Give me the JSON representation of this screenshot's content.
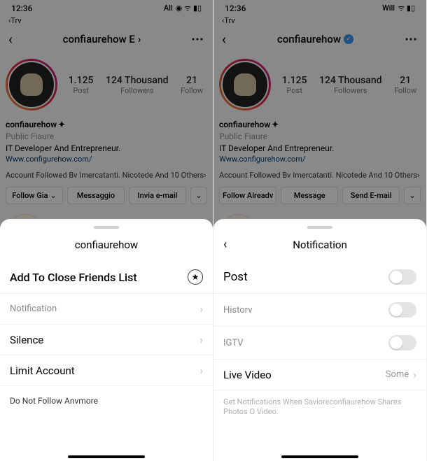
{
  "left": {
    "status": {
      "time": "12:36",
      "carrier": "All"
    },
    "nav": {
      "back_text": "Trv"
    },
    "header": {
      "title": "confiaurehow E",
      "verified": false
    },
    "stats": {
      "posts_num": "1.125",
      "posts_label": "Post",
      "followers_num": "124 Thousand",
      "followers_label": "Followers",
      "following_num": "21",
      "following_label": "Follow"
    },
    "bio": {
      "name": "confiaurehow",
      "category": "Public Fiaure",
      "headline": "IT Developer And Entrepreneur.",
      "link": "Www.configurehow.com/",
      "followed_by": "Account Followed Bv Imercatanti. Nicotede And 10 Others"
    },
    "buttons": {
      "follow": "Follow Gia",
      "message": "Messaggio",
      "email": "Invia e-mail"
    },
    "sheet": {
      "title": "confiaurehow",
      "close_friends": "Add To Close Friends List",
      "notification": "Notification",
      "silence": "Silence",
      "limit": "Limit Account",
      "unfollow": "Do Not Follow Anvmore"
    }
  },
  "right": {
    "status": {
      "time": "12:36",
      "carrier": "Will"
    },
    "nav": {
      "back_text": "Trv"
    },
    "header": {
      "title": "confiaurehow",
      "verified": true
    },
    "stats": {
      "posts_num": "1.125",
      "posts_label": "Post",
      "followers_num": "124 Thousand",
      "followers_label": "Followers",
      "following_num": "21",
      "following_label": "Follow"
    },
    "bio": {
      "name": "confiaurehow",
      "category": "Public Fiaure",
      "headline": "IT Developer And Entrepreneur.",
      "link": "Www.configurehow.com/",
      "followed_by": "Account Followed Bv Imercatanti. Nicotede And 10 Others"
    },
    "buttons": {
      "follow_already": "Follow Alreadv",
      "message": "Message",
      "email": "Send E-mail"
    },
    "sheet": {
      "title": "Notification",
      "post": "Post",
      "history": "Historv",
      "igtv": "IGTV",
      "live": "Live Video",
      "live_value": "Some",
      "info": "Get Notifications When Savioreconfiaurehow Shares Photos O Video."
    }
  }
}
